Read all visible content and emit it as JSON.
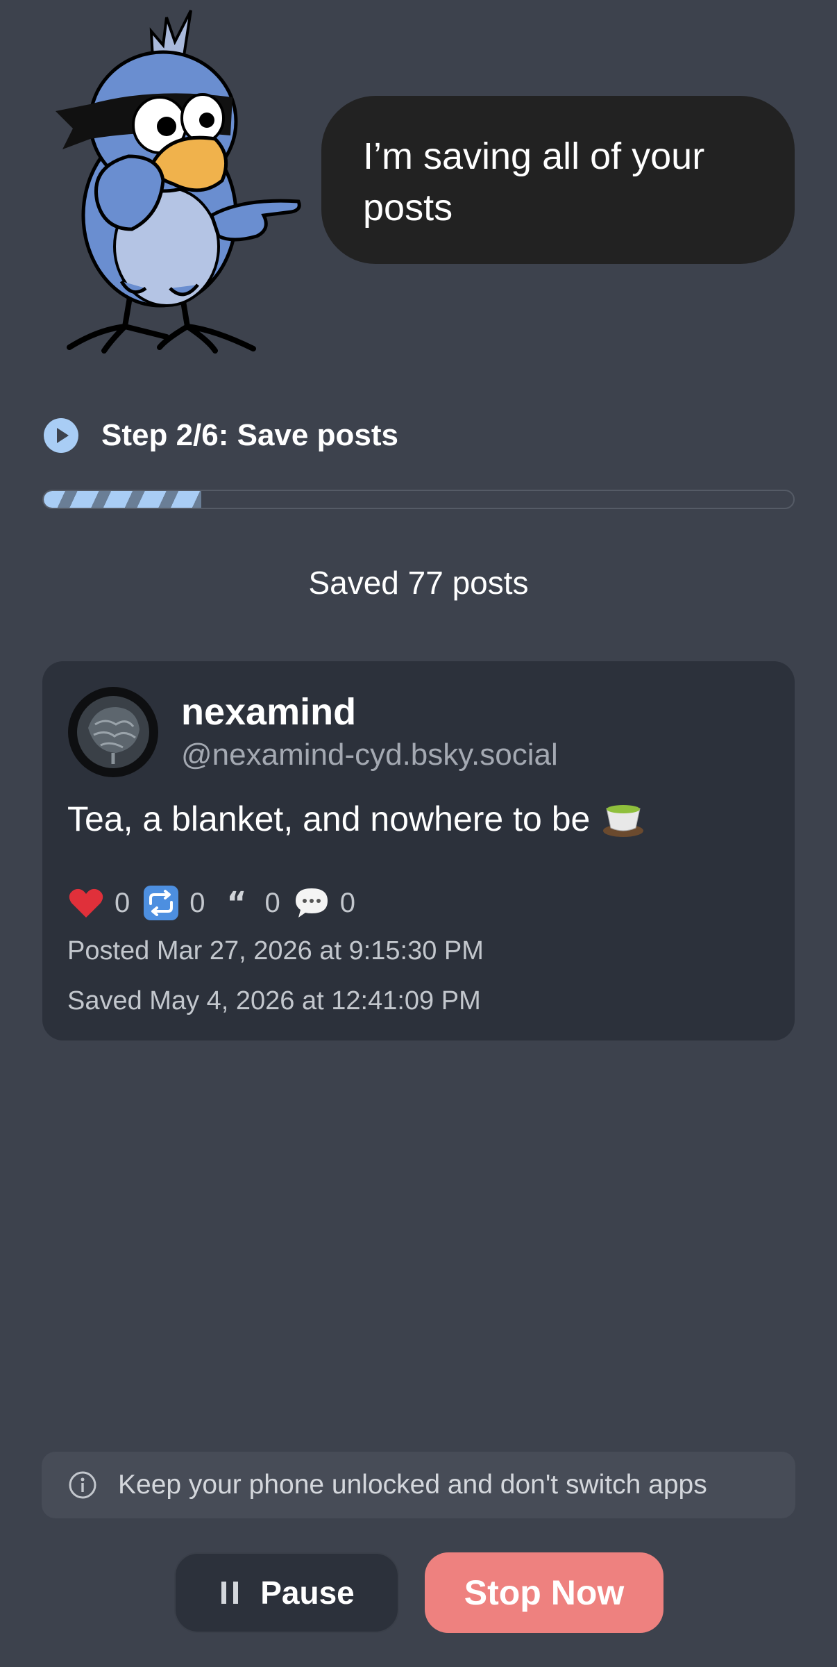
{
  "speech_bubble": {
    "text": "I’m saving all of your posts"
  },
  "progress": {
    "step_label": "Step 2/6: Save posts",
    "fraction": 0.21,
    "status": "Saved 77 posts"
  },
  "post": {
    "display_name": "nexamind",
    "handle": "@nexamind-cyd.bsky.social",
    "text": "Tea, a blanket, and nowhere to be",
    "text_emoji": "teacup-emoji",
    "stats": [
      {
        "icon": "heart-icon",
        "value": "0"
      },
      {
        "icon": "repost-icon",
        "value": "0"
      },
      {
        "icon": "quote-icon",
        "value": "0"
      },
      {
        "icon": "reply-icon",
        "value": "0"
      }
    ],
    "posted": "Posted Mar 27, 2026 at 9:15:30 PM",
    "saved": "Saved May 4, 2026 at 12:41:09 PM"
  },
  "notice": {
    "text": "Keep your phone unlocked and don't switch apps",
    "icon": "info-icon"
  },
  "buttons": {
    "pause": "Pause",
    "stop": "Stop Now"
  },
  "colors": {
    "background": "#3d424d",
    "card": "#2c313b",
    "accent_blue": "#a9cdf5",
    "stop_button": "#ee817f"
  }
}
